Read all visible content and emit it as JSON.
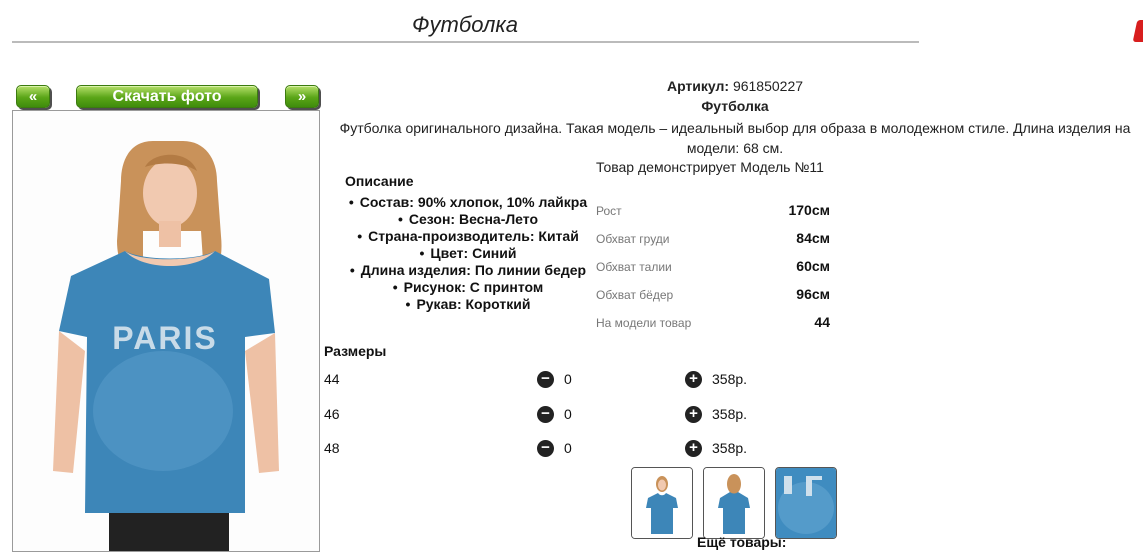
{
  "page": {
    "title": "Футболка"
  },
  "gallery": {
    "prev_label": "«",
    "download_label": "Скачать фото",
    "next_label": "»",
    "shirt_print": "PARIS"
  },
  "product": {
    "article_label": "Артикул:",
    "article_value": "961850227",
    "name": "Футболка",
    "description": "Футболка оригинального дизайна. Такая модель – идеальный выбор для образа в молодежном стиле. Длина изделия на модели: 68 см."
  },
  "description_block": {
    "title": "Описание",
    "features": [
      "Состав: 90% хлопок, 10% лайкра",
      "Сезон: Весна-Лето",
      "Страна-производитель: Китай",
      "Цвет: Синий",
      "Длина изделия: По линии бедер",
      "Рисунок: С принтом",
      "Рукав: Короткий"
    ]
  },
  "model": {
    "title": "Товар демонстрирует Модель №11",
    "measurements": [
      {
        "label": "Рост",
        "value": "170см"
      },
      {
        "label": "Обхват груди",
        "value": "84см"
      },
      {
        "label": "Обхват талии",
        "value": "60см"
      },
      {
        "label": "Обхват бёдер",
        "value": "96см"
      },
      {
        "label": "На модели товар",
        "value": "44"
      }
    ]
  },
  "sizes": {
    "title": "Размеры",
    "rows": [
      {
        "size": "44",
        "qty": "0",
        "price": "358р."
      },
      {
        "size": "46",
        "qty": "0",
        "price": "358р."
      },
      {
        "size": "48",
        "qty": "0",
        "price": "358р."
      }
    ]
  },
  "more_products": "Ещё товары:",
  "colors": {
    "button_green": "#5aa517",
    "denim": "#3d86b8",
    "accent_red": "#d81e1e"
  }
}
